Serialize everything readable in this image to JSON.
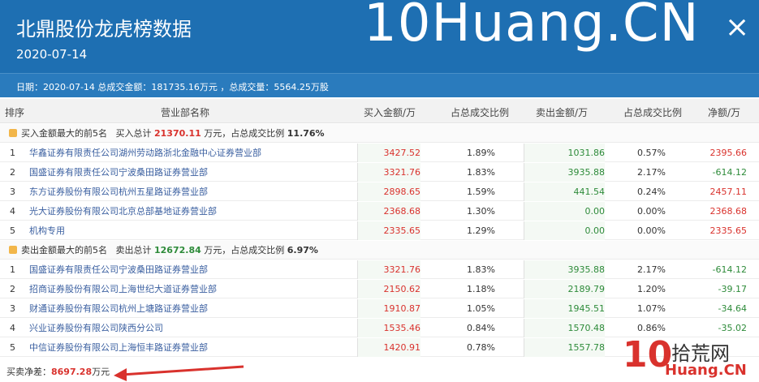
{
  "header": {
    "title": "北鼎股份龙虎榜数据",
    "date": "2020-07-14",
    "brand": "10Huang.CN",
    "close": "×",
    "info": "日期：2020-07-14 总成交金额：181735.16万元 ，总成交量：5564.25万股"
  },
  "columns": [
    "排序",
    "营业部名称",
    "买入金额/万",
    "占总成交比例",
    "卖出金额/万",
    "占总成交比例",
    "净额/万"
  ],
  "buy_section": {
    "prefix": "买入金额最大的前5名",
    "total_label": "买入总计",
    "total": "21370.11",
    "unit_mid": "万元，占总成交比例",
    "ratio": "11.76%",
    "rows": [
      {
        "rank": "1",
        "name": "华鑫证券有限责任公司湖州劳动路浙北金融中心证券营业部",
        "buy": "3427.52",
        "buy_pct": "1.89%",
        "sell": "1031.86",
        "sell_pct": "0.57%",
        "net": "2395.66"
      },
      {
        "rank": "2",
        "name": "国盛证券有限责任公司宁波桑田路证券营业部",
        "buy": "3321.76",
        "buy_pct": "1.83%",
        "sell": "3935.88",
        "sell_pct": "2.17%",
        "net": "-614.12"
      },
      {
        "rank": "3",
        "name": "东方证券股份有限公司杭州五星路证券营业部",
        "buy": "2898.65",
        "buy_pct": "1.59%",
        "sell": "441.54",
        "sell_pct": "0.24%",
        "net": "2457.11"
      },
      {
        "rank": "4",
        "name": "光大证券股份有限公司北京总部基地证券营业部",
        "buy": "2368.68",
        "buy_pct": "1.30%",
        "sell": "0.00",
        "sell_pct": "0.00%",
        "net": "2368.68"
      },
      {
        "rank": "5",
        "name": "机构专用",
        "buy": "2335.65",
        "buy_pct": "1.29%",
        "sell": "0.00",
        "sell_pct": "0.00%",
        "net": "2335.65"
      }
    ]
  },
  "sell_section": {
    "prefix": "卖出金额最大的前5名",
    "total_label": "卖出总计",
    "total": "12672.84",
    "unit_mid": "万元，占总成交比例",
    "ratio": "6.97%",
    "rows": [
      {
        "rank": "1",
        "name": "国盛证券有限责任公司宁波桑田路证券营业部",
        "buy": "3321.76",
        "buy_pct": "1.83%",
        "sell": "3935.88",
        "sell_pct": "2.17%",
        "net": "-614.12"
      },
      {
        "rank": "2",
        "name": "招商证券股份有限公司上海世纪大道证券营业部",
        "buy": "2150.62",
        "buy_pct": "1.18%",
        "sell": "2189.79",
        "sell_pct": "1.20%",
        "net": "-39.17"
      },
      {
        "rank": "3",
        "name": "财通证券股份有限公司杭州上塘路证券营业部",
        "buy": "1910.87",
        "buy_pct": "1.05%",
        "sell": "1945.51",
        "sell_pct": "1.07%",
        "net": "-34.64"
      },
      {
        "rank": "4",
        "name": "兴业证券股份有限公司陕西分公司",
        "buy": "1535.46",
        "buy_pct": "0.84%",
        "sell": "1570.48",
        "sell_pct": "0.86%",
        "net": "-35.02"
      },
      {
        "rank": "5",
        "name": "中信证券股份有限公司上海恒丰路证券营业部",
        "buy": "1420.91",
        "buy_pct": "0.78%",
        "sell": "1557.78",
        "sell_pct": "",
        "net": ""
      }
    ]
  },
  "footer": {
    "label": "买卖净差：",
    "value": "8697.28",
    "unit": "万元"
  },
  "watermark": {
    "ten": "10",
    "cn": "拾荒网",
    "sub": "Huang.CN"
  },
  "colors": {
    "header_bg": "#1e6fb2",
    "buy": "#d9322d",
    "sell": "#2e8b3a",
    "link": "#3a5fa0"
  }
}
